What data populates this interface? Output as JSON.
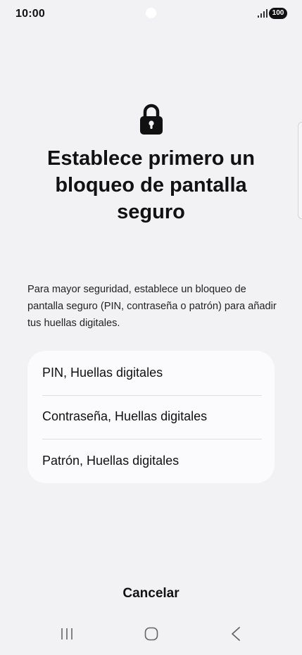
{
  "status_bar": {
    "time": "10:00",
    "battery": "100",
    "signal_icon": "signal-bars-icon"
  },
  "lock_icon": "padlock-icon",
  "title": "Establece primero un bloqueo de pantalla seguro",
  "description": "Para mayor seguridad, establece un bloqueo de pantalla seguro (PIN, contraseña o patrón) para añadir tus huellas digitales.",
  "options": [
    {
      "label": "PIN, Huellas digitales"
    },
    {
      "label": "Contraseña, Huellas digitales"
    },
    {
      "label": "Patrón, Huellas digitales"
    }
  ],
  "cancel_label": "Cancelar",
  "nav_bar": {
    "recent_icon": "recent-apps-icon",
    "home_icon": "home-icon",
    "back_icon": "back-icon"
  },
  "colors": {
    "background": "#f2f2f5",
    "card": "#fbfbfd",
    "text": "#111111"
  }
}
